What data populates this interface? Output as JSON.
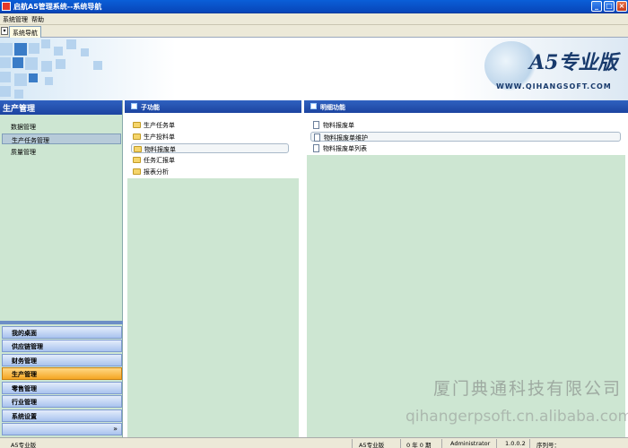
{
  "window": {
    "title": "启航A5管理系统--系统导航",
    "minimize_glyph": "_",
    "maximize_glyph": "□",
    "close_glyph": "×",
    "icon": "app-icon"
  },
  "menubar": {
    "items": [
      "系统管理",
      "帮助"
    ]
  },
  "tabstrip": {
    "arrow_glyph": "▾",
    "active_tab": "系统导航"
  },
  "banner": {
    "logo_text": "A5专业版",
    "url_text": "WWW.QIHANGSOFT.COM"
  },
  "left_panel": {
    "title": "生产管理",
    "items": [
      "数据管理",
      "生产任务管理",
      "质量管理"
    ],
    "selected_index": 1,
    "nav_buttons": [
      "我的桌面",
      "供应链管理",
      "财务管理",
      "生产管理",
      "零售管理",
      "行业管理",
      "系统设置"
    ],
    "active_nav_index": 3,
    "more_glyph": "»"
  },
  "sub_panel": {
    "title": "子功能",
    "items": [
      "生产任务单",
      "生产投料单",
      "物料报废单",
      "任务汇报单",
      "报表分析"
    ],
    "selected_index": 2
  },
  "detail_panel": {
    "title": "明细功能",
    "items": [
      "物料报废单",
      "物料报废单维护",
      "物料报废单列表"
    ],
    "selected_index": 1
  },
  "watermark": {
    "company": "厦门典通科技有限公司",
    "site": "qihangerpsoft.cn.alibaba.com"
  },
  "statusbar": {
    "edition": "A5专业版",
    "edition2": "A5专业版",
    "period": "0 年 0 期",
    "user": "Administrator",
    "version": "1.0.0.2",
    "serial_label": "序列号："
  },
  "colors": {
    "header_blue": "#1c44a0",
    "panel_green": "#cde6d2",
    "active_orange": "#f5a623"
  }
}
